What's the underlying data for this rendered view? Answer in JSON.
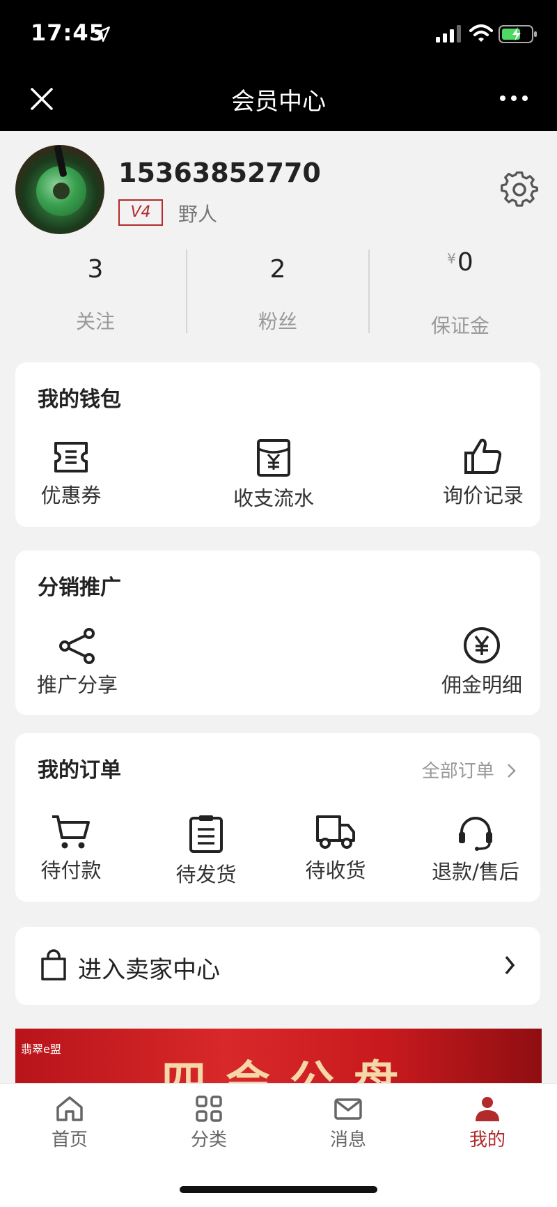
{
  "status_bar": {
    "time": "17:45"
  },
  "nav": {
    "title": "会员中心"
  },
  "profile": {
    "phone": "15363852770",
    "level": "V4",
    "nickname": "野人"
  },
  "stats": [
    {
      "value": "3",
      "label": "关注"
    },
    {
      "value": "2",
      "label": "粉丝"
    },
    {
      "currency": "¥",
      "value": "0",
      "label": "保证金"
    }
  ],
  "wallet": {
    "title": "我的钱包",
    "items": [
      {
        "label": "优惠券",
        "icon": "coupon-icon"
      },
      {
        "label": "收支流水",
        "icon": "money-envelope-icon"
      },
      {
        "label": "询价记录",
        "icon": "thumbs-up-icon"
      }
    ]
  },
  "distribution": {
    "title": "分销推广",
    "items": [
      {
        "label": "推广分享",
        "icon": "share-icon"
      },
      {
        "label": "佣金明细",
        "icon": "yen-circle-icon"
      }
    ]
  },
  "orders": {
    "title": "我的订单",
    "all_link": "全部订单",
    "items": [
      {
        "label": "待付款",
        "icon": "cart-icon"
      },
      {
        "label": "待发货",
        "icon": "clipboard-icon"
      },
      {
        "label": "待收货",
        "icon": "truck-icon"
      },
      {
        "label": "退款/售后",
        "icon": "headset-icon"
      }
    ]
  },
  "seller": {
    "label": "进入卖家中心",
    "icon": "shopping-bag-icon"
  },
  "banner": {
    "logo_text": "翡翠e盟",
    "headline": "四会公盘"
  },
  "tabs": [
    {
      "label": "首页",
      "icon": "home-icon",
      "active": false
    },
    {
      "label": "分类",
      "icon": "grid-icon",
      "active": false
    },
    {
      "label": "消息",
      "icon": "mail-icon",
      "active": false
    },
    {
      "label": "我的",
      "icon": "user-icon",
      "active": true
    }
  ],
  "colors": {
    "accent": "#b22a2a",
    "header": "#000000",
    "background": "#f2f2f2"
  }
}
